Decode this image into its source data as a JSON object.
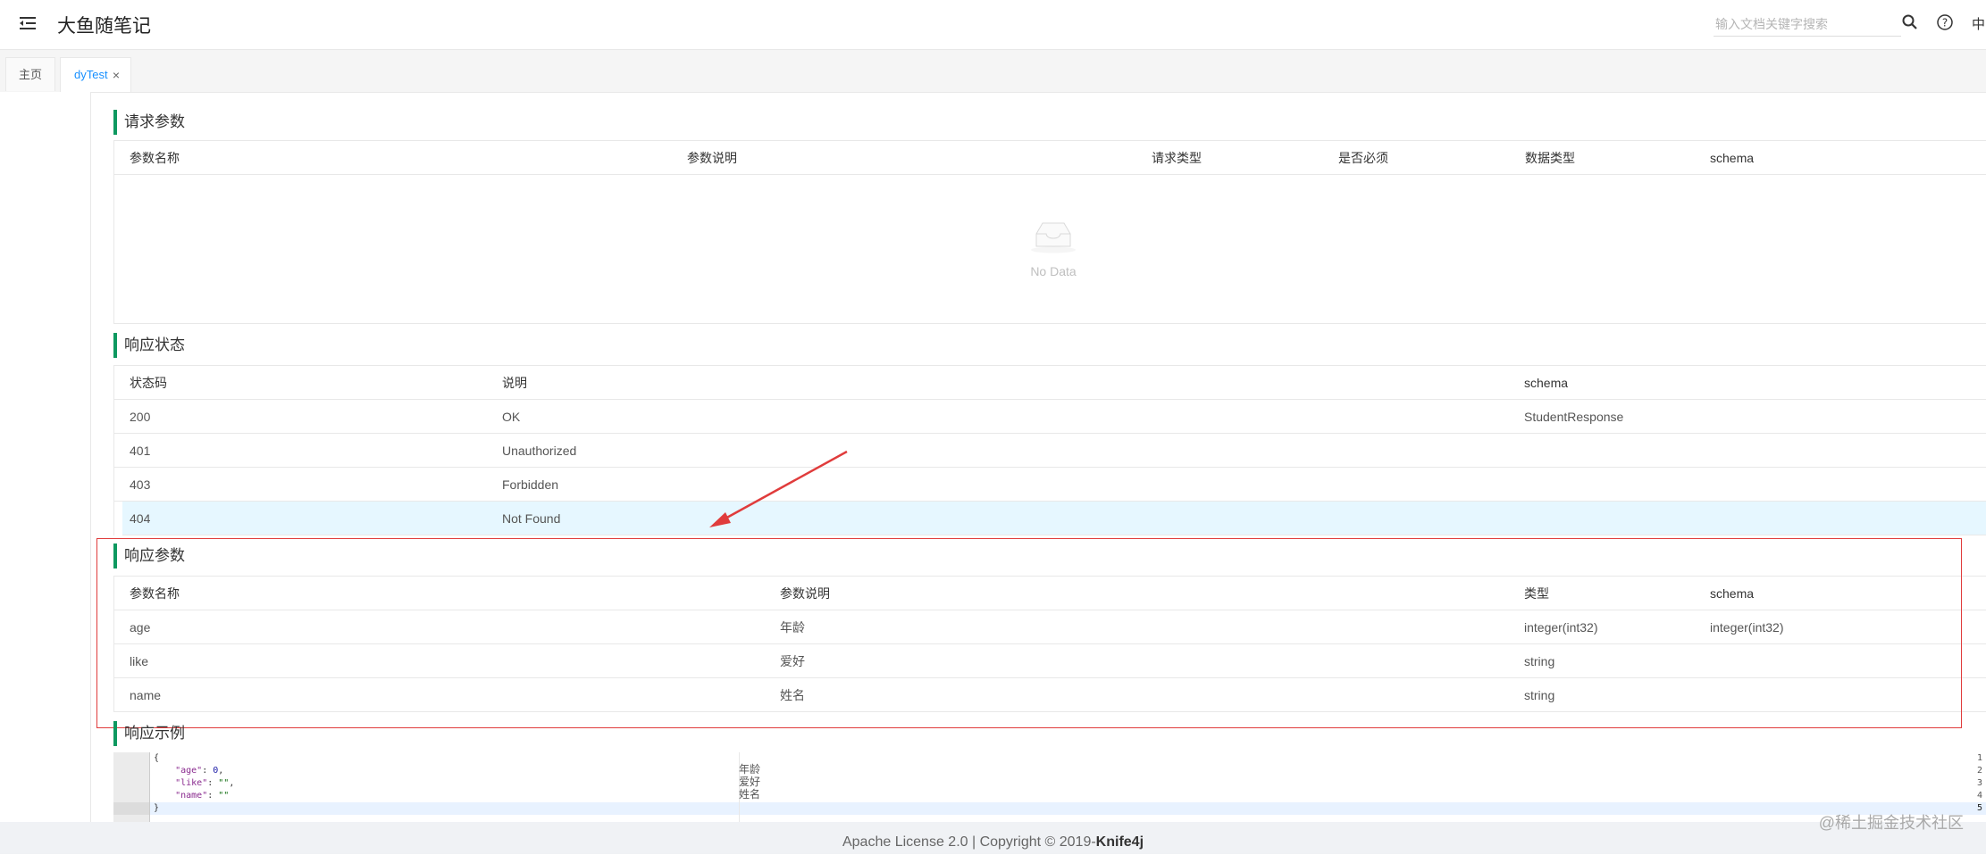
{
  "header": {
    "title": "大鱼随笔记",
    "search_placeholder": "输入文档关键字搜索",
    "lang": "中"
  },
  "tabs": [
    {
      "label": "主页"
    },
    {
      "label": "dyTest",
      "close": "×"
    }
  ],
  "request_params": {
    "title": "请求参数",
    "columns": [
      "参数名称",
      "参数说明",
      "请求类型",
      "是否必须",
      "数据类型",
      "schema"
    ],
    "empty_text": "No Data"
  },
  "response_status": {
    "title": "响应状态",
    "columns": [
      "状态码",
      "说明",
      "schema"
    ],
    "rows": [
      {
        "code": "200",
        "desc": "OK",
        "schema": "StudentResponse"
      },
      {
        "code": "401",
        "desc": "Unauthorized",
        "schema": ""
      },
      {
        "code": "403",
        "desc": "Forbidden",
        "schema": ""
      },
      {
        "code": "404",
        "desc": "Not Found",
        "schema": ""
      }
    ]
  },
  "response_params": {
    "title": "响应参数",
    "columns": [
      "参数名称",
      "参数说明",
      "类型",
      "schema"
    ],
    "rows": [
      {
        "name": "age",
        "desc": "年龄",
        "type": "integer(int32)",
        "schema": "integer(int32)"
      },
      {
        "name": "like",
        "desc": "爱好",
        "type": "string",
        "schema": ""
      },
      {
        "name": "name",
        "desc": "姓名",
        "type": "string",
        "schema": ""
      }
    ]
  },
  "response_example": {
    "title": "响应示例",
    "line_numbers": [
      "1",
      "2",
      "3",
      "4",
      "5"
    ],
    "comments": [
      "年龄",
      "爱好",
      "姓名"
    ]
  },
  "footer": {
    "license": "Apache License 2.0 | Copyright ",
    "copyright_symbol": "©",
    "year": " 2019-",
    "brand": "Knife4j"
  },
  "watermark": "@稀土掘金技术社区",
  "colors": {
    "accent_green": "#0e9960",
    "tab_active": "#1890ff",
    "highlight_row": "#e6f7ff",
    "annotation_red": "#e03c3c"
  }
}
